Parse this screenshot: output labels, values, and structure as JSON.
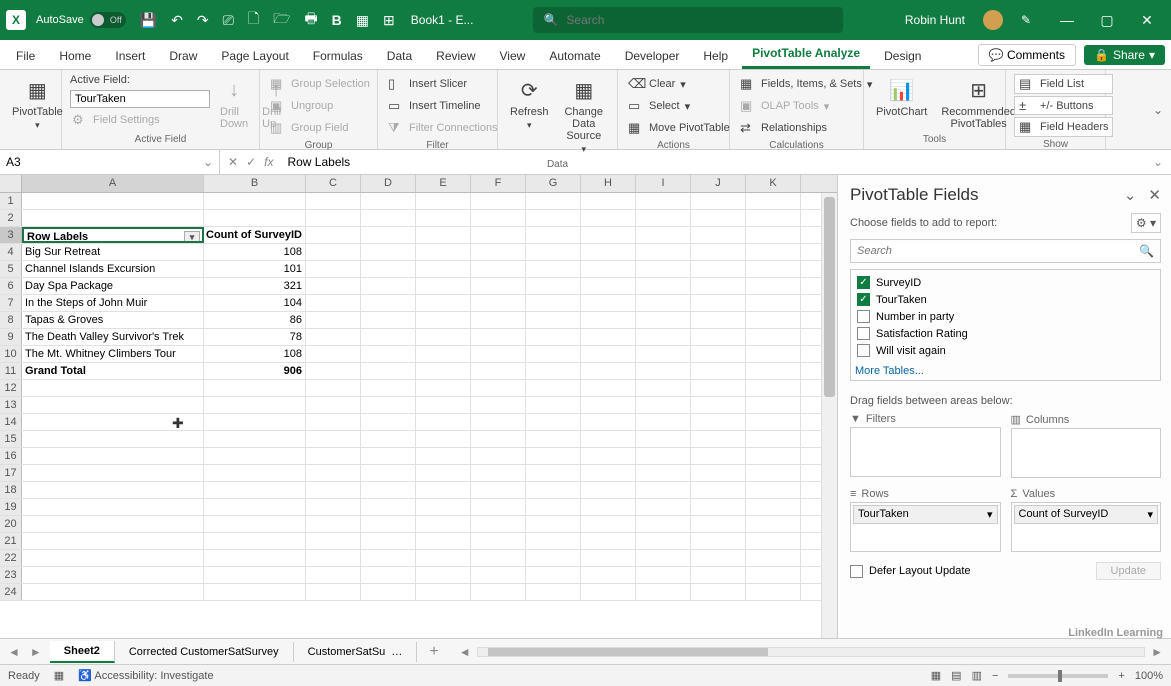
{
  "titlebar": {
    "autosave_label": "AutoSave",
    "autosave_state": "Off",
    "doc_name": "Book1 - E...",
    "search_placeholder": "Search",
    "user_name": "Robin Hunt"
  },
  "tabs": {
    "items": [
      "File",
      "Home",
      "Insert",
      "Draw",
      "Page Layout",
      "Formulas",
      "Data",
      "Review",
      "View",
      "Automate",
      "Developer",
      "Help",
      "PivotTable Analyze",
      "Design"
    ],
    "active": "PivotTable Analyze",
    "comments": "Comments",
    "share": "Share"
  },
  "ribbon": {
    "pivottable": {
      "btn": "PivotTable",
      "group": ""
    },
    "active_field": {
      "label": "Active Field:",
      "value": "TourTaken",
      "field_settings": "Field Settings",
      "drill_down": "Drill Down",
      "drill_up": "Drill Up",
      "group": "Active Field"
    },
    "group": {
      "sel": "Group Selection",
      "ungroup": "Ungroup",
      "field": "Group Field",
      "label": "Group"
    },
    "filter": {
      "slicer": "Insert Slicer",
      "timeline": "Insert Timeline",
      "conn": "Filter Connections",
      "label": "Filter"
    },
    "data": {
      "refresh": "Refresh",
      "change": "Change Data Source",
      "label": "Data"
    },
    "actions": {
      "clear": "Clear",
      "select": "Select",
      "move": "Move PivotTable",
      "label": "Actions"
    },
    "calc": {
      "fields": "Fields, Items, & Sets",
      "olap": "OLAP Tools",
      "rel": "Relationships",
      "label": "Calculations"
    },
    "tools": {
      "chart": "PivotChart",
      "rec": "Recommended PivotTables",
      "label": "Tools"
    },
    "show": {
      "list": "Field List",
      "btns": "+/- Buttons",
      "hdrs": "Field Headers",
      "label": "Show"
    }
  },
  "formula_bar": {
    "name": "A3",
    "formula": "Row Labels"
  },
  "columns": [
    "A",
    "B",
    "C",
    "D",
    "E",
    "F",
    "G",
    "H",
    "I",
    "J",
    "K"
  ],
  "grid": {
    "header_a": "Row Labels",
    "header_b": "Count of SurveyID",
    "rows": [
      {
        "a": "Big Sur Retreat",
        "b": "108"
      },
      {
        "a": "Channel Islands Excursion",
        "b": "101"
      },
      {
        "a": "Day Spa Package",
        "b": "321"
      },
      {
        "a": "In the Steps of John Muir",
        "b": "104"
      },
      {
        "a": "Tapas & Groves",
        "b": "86"
      },
      {
        "a": "The Death Valley Survivor's Trek",
        "b": "78"
      },
      {
        "a": "The Mt. Whitney Climbers Tour",
        "b": "108"
      }
    ],
    "total_label": "Grand Total",
    "total_value": "906"
  },
  "pane": {
    "title": "PivotTable Fields",
    "sub": "Choose fields to add to report:",
    "search_placeholder": "Search",
    "fields": [
      {
        "name": "SurveyID",
        "checked": true
      },
      {
        "name": "TourTaken",
        "checked": true
      },
      {
        "name": "Number in party",
        "checked": false
      },
      {
        "name": "Satisfaction Rating",
        "checked": false
      },
      {
        "name": "Will visit again",
        "checked": false
      }
    ],
    "more": "More Tables...",
    "drag_msg": "Drag fields between areas below:",
    "areas": {
      "filters": "Filters",
      "columns": "Columns",
      "rows": "Rows",
      "values": "Values",
      "rows_chip": "TourTaken",
      "values_chip": "Count of SurveyID"
    },
    "defer": "Defer Layout Update",
    "update": "Update"
  },
  "sheets": {
    "items": [
      "Sheet2",
      "Corrected CustomerSatSurvey",
      "CustomerSatSu"
    ],
    "active": "Sheet2"
  },
  "status": {
    "ready": "Ready",
    "access": "Accessibility: Investigate",
    "zoom": "100%"
  },
  "watermark": "LinkedIn Learning"
}
